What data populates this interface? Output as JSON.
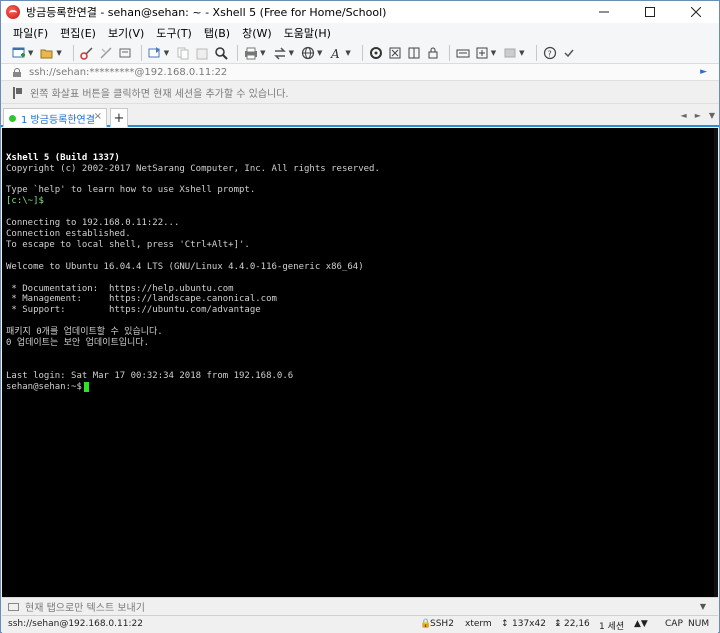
{
  "window": {
    "title": "방금등록한연결 - sehan@sehan: ~ - Xshell 5 (Free for Home/School)"
  },
  "menu": [
    "파일(F)",
    "편집(E)",
    "보기(V)",
    "도구(T)",
    "탭(B)",
    "창(W)",
    "도움말(H)"
  ],
  "address": {
    "text": "ssh://sehan:*********@192.168.0.11:22"
  },
  "hint": {
    "text": "왼쪽 화살표 버튼을 클릭하면 현재 세션을 추가할 수 있습니다."
  },
  "tab": {
    "label": "1 방금등록한연결",
    "close": "×",
    "add": "+"
  },
  "terminal": {
    "lines": [
      {
        "text": "Xshell 5 (Build 1337)",
        "style": "bold"
      },
      {
        "text": "Copyright (c) 2002-2017 NetSarang Computer, Inc. All rights reserved.",
        "style": ""
      },
      {
        "text": "",
        "style": ""
      },
      {
        "text": "Type `help' to learn how to use Xshell prompt.",
        "style": ""
      },
      {
        "text": "[c:\\~]$",
        "style": "green"
      },
      {
        "text": "",
        "style": ""
      },
      {
        "text": "Connecting to 192.168.0.11:22...",
        "style": ""
      },
      {
        "text": "Connection established.",
        "style": ""
      },
      {
        "text": "To escape to local shell, press 'Ctrl+Alt+]'.",
        "style": ""
      },
      {
        "text": "",
        "style": ""
      },
      {
        "text": "Welcome to Ubuntu 16.04.4 LTS (GNU/Linux 4.4.0-116-generic x86_64)",
        "style": ""
      },
      {
        "text": "",
        "style": ""
      },
      {
        "text": " * Documentation:  https://help.ubuntu.com",
        "style": ""
      },
      {
        "text": " * Management:     https://landscape.canonical.com",
        "style": ""
      },
      {
        "text": " * Support:        https://ubuntu.com/advantage",
        "style": ""
      },
      {
        "text": "",
        "style": ""
      },
      {
        "text": "패키지 0개를 업데이트할 수 있습니다.",
        "style": ""
      },
      {
        "text": "0 업데이트는 보안 업데이트입니다.",
        "style": ""
      },
      {
        "text": "",
        "style": ""
      },
      {
        "text": "",
        "style": ""
      },
      {
        "text": "Last login: Sat Mar 17 00:32:34 2018 from 192.168.0.6",
        "style": ""
      }
    ],
    "prompt": "sehan@sehan:~$"
  },
  "compose": {
    "text": "현재 탭으로만 텍스트 보내기"
  },
  "status": {
    "connection": "ssh://sehan@192.168.0.11:22",
    "protocol": "SSH2",
    "terminal_type": "xterm",
    "size": "137x42",
    "cursor_pos": "22,16",
    "sessions": "1 세션",
    "caps": "CAP",
    "num": "NUM"
  },
  "icons": {
    "app": "xshell-logo-icon",
    "toolbar": [
      "new-session-icon",
      "open-folder-icon",
      "link-icon",
      "unlink-icon",
      "reconnect-icon",
      "copy-icon",
      "paste-icon",
      "find-icon",
      "print-icon",
      "transfer-icon",
      "globe-icon",
      "font-icon",
      "xftp-icon",
      "fullscreen-icon",
      "lock-icon",
      "keyboard-icon",
      "add-icon",
      "layout-icon",
      "help-icon",
      "more-icon"
    ]
  }
}
